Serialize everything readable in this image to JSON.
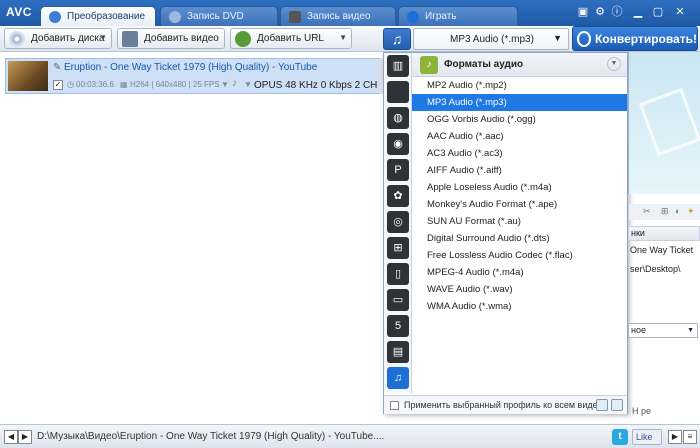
{
  "app": {
    "logo": "AVC"
  },
  "tabs": [
    {
      "label": "Преобразование",
      "active": true
    },
    {
      "label": "Запись DVD",
      "active": false
    },
    {
      "label": "Запись видео",
      "active": false
    },
    {
      "label": "Играть",
      "active": false
    }
  ],
  "toolbar": {
    "add_disc": "Добавить диска",
    "add_video": "Добавить видео",
    "add_url": "Добавить URL",
    "format_selected": "MP3 Audio (*.mp3)",
    "convert": "Конвертировать!"
  },
  "file": {
    "title": "Eruption - One Way Ticket 1979 (High Quality) - YouTube",
    "duration": "00:03:36.6",
    "video_info": "H264 | 640x480 | 25 FPS",
    "audio_info": "OPUS 48 KHz 0 Kbps 2 CH"
  },
  "format_panel": {
    "header": "Форматы аудио",
    "items": [
      "MP2 Audio (*.mp2)",
      "MP3 Audio (*.mp3)",
      "OGG Vorbis Audio (*.ogg)",
      "AAC Audio (*.aac)",
      "AC3 Audio (*.ac3)",
      "AIFF Audio (*.aiff)",
      "Apple Loseless Audio (*.m4a)",
      "Monkey's Audio Format (*.ape)",
      "SUN AU Format (*.au)",
      "Digital Surround Audio (*.dts)",
      "Free Lossless Audio Codec (*.flac)",
      "MPEG-4 Audio (*.m4a)",
      "WAVE Audio (*.wav)",
      "WMA Audio (*.wma)"
    ],
    "selected_index": 1,
    "footer": "Применить выбранный профиль ко всем виде",
    "categories": [
      "stats-icon",
      "apple-icon",
      "android-robot-icon",
      "android-icon",
      "playstation-icon",
      "huawei-icon",
      "globe-icon",
      "windows-icon",
      "phone-icon",
      "tv-icon",
      "html5-icon",
      "film-icon",
      "music-icon"
    ]
  },
  "right_panel": {
    "header": "нки",
    "title_value": "One Way Ticket",
    "path_value": "ser\\Desktop\\",
    "select_value": "ное",
    "footer": "Н ре"
  },
  "status": {
    "path": "D:\\Музыка\\Видео\\Eruption - One Way Ticket 1979 (High Quality) - YouTube....",
    "like": "Like",
    "twitter": "t"
  }
}
